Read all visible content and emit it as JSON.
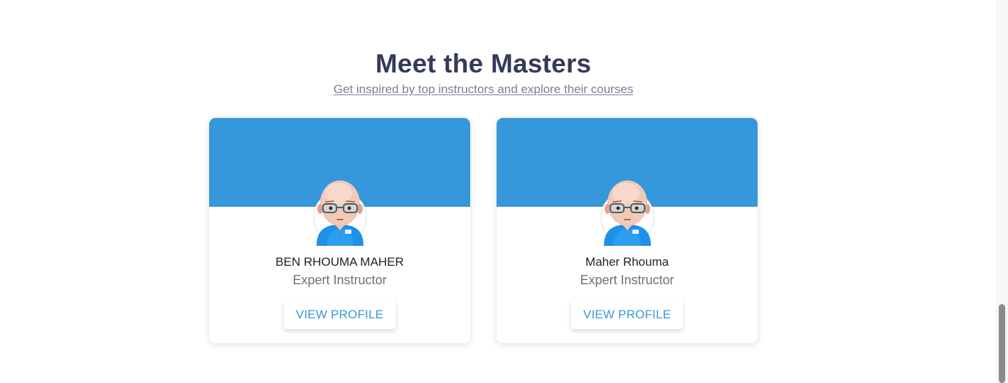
{
  "section": {
    "title": "Meet the Masters",
    "subtitle": "Get inspired by top instructors and explore their courses"
  },
  "colors": {
    "banner": "#3797db",
    "title": "#353a5a",
    "link": "#3797db"
  },
  "instructors": [
    {
      "name": "BEN RHOUMA MAHER",
      "role": "Expert Instructor",
      "button": "VIEW PROFILE",
      "avatar_icon": "instructor-avatar-icon"
    },
    {
      "name": "Maher Rhouma",
      "role": "Expert Instructor",
      "button": "VIEW PROFILE",
      "avatar_icon": "instructor-avatar-icon"
    }
  ]
}
